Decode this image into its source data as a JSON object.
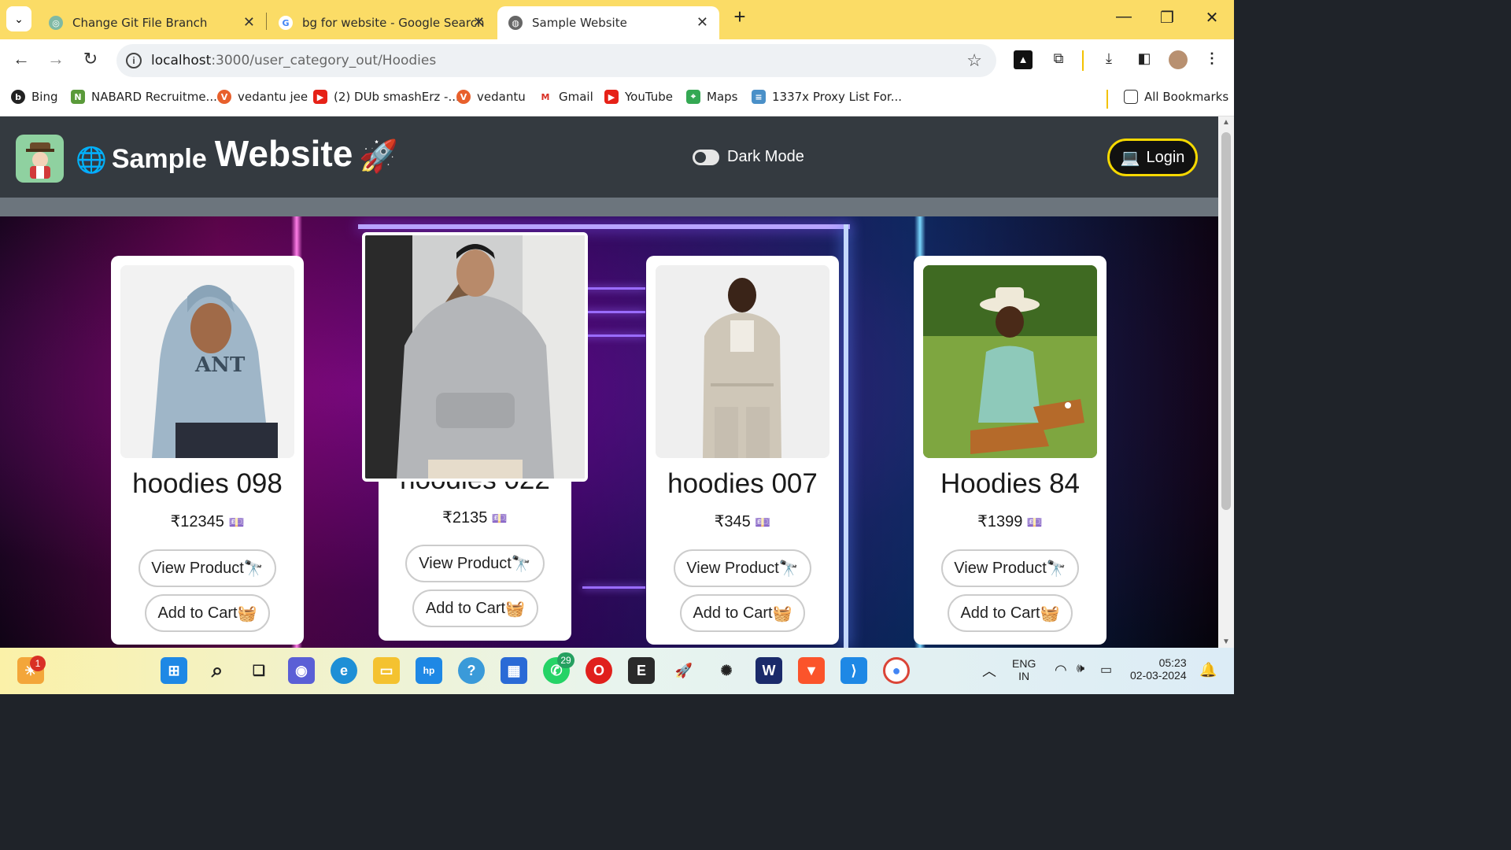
{
  "browser": {
    "tabs": [
      {
        "title": "Change Git File Branch",
        "active": false
      },
      {
        "title": "bg for website - Google Search",
        "active": false
      },
      {
        "title": "Sample Website",
        "active": true
      }
    ],
    "url_host": "localhost",
    "url_path": ":3000/user_category_out/Hoodies",
    "bookmarks": [
      {
        "label": "Bing"
      },
      {
        "label": "NABARD Recruitme..."
      },
      {
        "label": "vedantu jee"
      },
      {
        "label": "(2) DUb smashErz -..."
      },
      {
        "label": "vedantu"
      },
      {
        "label": "Gmail"
      },
      {
        "label": "YouTube"
      },
      {
        "label": "Maps"
      },
      {
        "label": "1337x Proxy List For..."
      }
    ],
    "all_bookmarks": "All Bookmarks"
  },
  "site": {
    "brand_part1": "Sample",
    "brand_part2": "Website",
    "dark_mode_label": "Dark Mode",
    "login_label": "Login"
  },
  "products": [
    {
      "name": "hoodies 098",
      "price": "₹12345",
      "view_label": "View Product",
      "cart_label": "Add to Cart"
    },
    {
      "name": "hoodies 022",
      "price": "₹2135",
      "view_label": "View Product",
      "cart_label": "Add to Cart"
    },
    {
      "name": "hoodies 007",
      "price": "₹345",
      "view_label": "View Product",
      "cart_label": "Add to Cart"
    },
    {
      "name": "Hoodies 84",
      "price": "₹1399",
      "view_label": "View Product",
      "cart_label": "Add to Cart"
    }
  ],
  "taskbar": {
    "lang_top": "ENG",
    "lang_bottom": "IN",
    "time": "05:23",
    "date": "02-03-2024",
    "badge_whatsapp": "29",
    "badge_widget": "1"
  }
}
